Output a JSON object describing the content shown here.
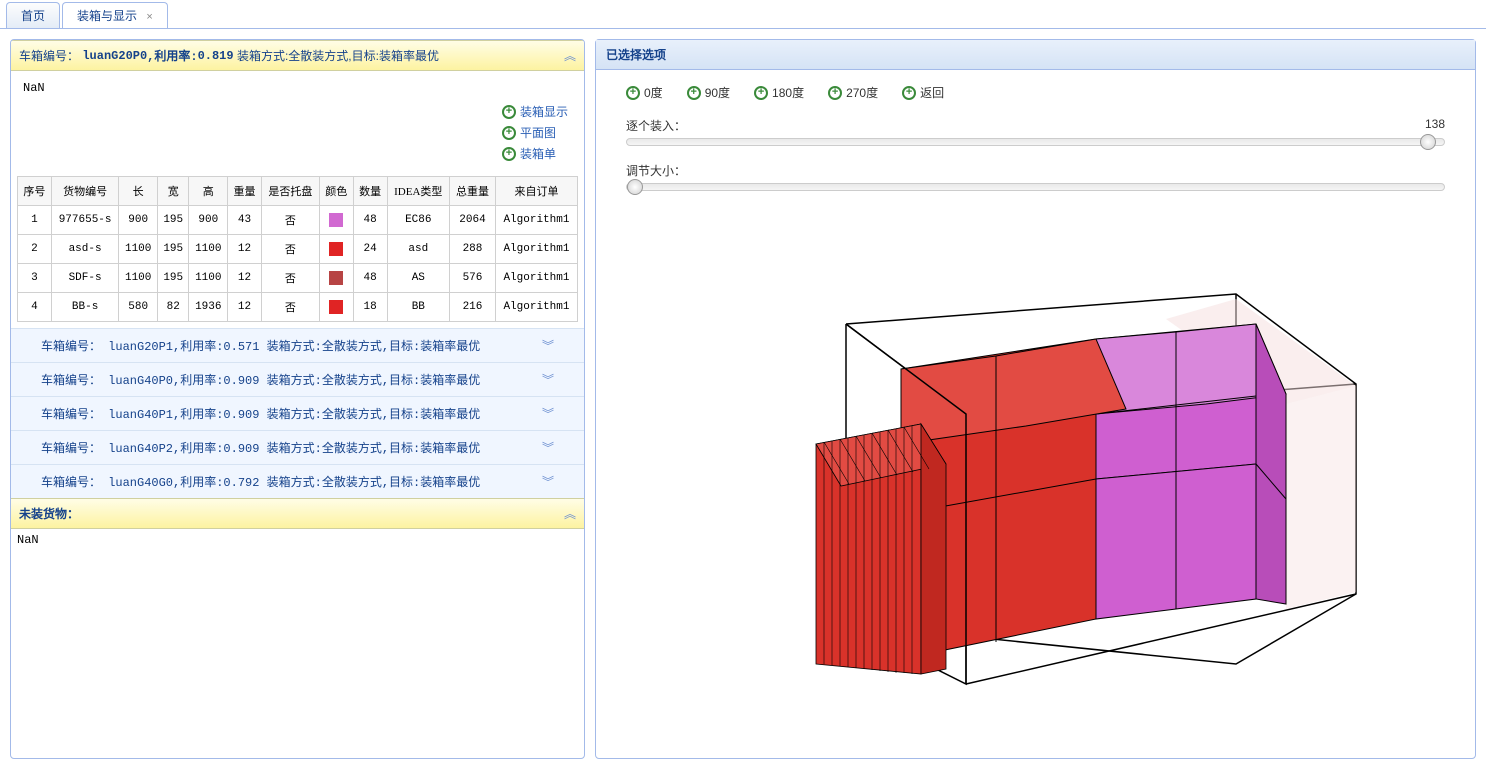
{
  "tabs": {
    "home": "首页",
    "pack": "装箱与显示"
  },
  "leftPanel": {
    "header": {
      "prefix": "车箱编号：",
      "id": "luanG20P0",
      "rateLabel": ",利用率:",
      "rate": "0.819",
      "methodLabel": "装箱方式:",
      "method": "全散装方式",
      "targetLabel": ",目标:",
      "target": "装箱率最优"
    },
    "nan": "NaN",
    "actions": {
      "showPack": "装箱显示",
      "planView": "平面图",
      "packList": "装箱单"
    },
    "tableHeaders": {
      "seq": "序号",
      "cargoId": "货物编号",
      "len": "长",
      "wid": "宽",
      "hei": "高",
      "wgt": "重量",
      "pallet": "是否托盘",
      "color": "颜色",
      "qty": "数量",
      "ideaType": "IDEA类型",
      "totalWgt": "总重量",
      "fromOrder": "来自订单"
    },
    "rows": [
      {
        "seq": "1",
        "cargoId": "977655-s",
        "len": "900",
        "wid": "195",
        "hei": "900",
        "wgt": "43",
        "pallet": "否",
        "color": "#d169d1",
        "qty": "48",
        "ideaType": "EC86",
        "totalWgt": "2064",
        "fromOrder": "Algorithm1"
      },
      {
        "seq": "2",
        "cargoId": "asd-s",
        "len": "1100",
        "wid": "195",
        "hei": "1100",
        "wgt": "12",
        "pallet": "否",
        "color": "#e02424",
        "qty": "24",
        "ideaType": "asd",
        "totalWgt": "288",
        "fromOrder": "Algorithm1"
      },
      {
        "seq": "3",
        "cargoId": "SDF-s",
        "len": "1100",
        "wid": "195",
        "hei": "1100",
        "wgt": "12",
        "pallet": "否",
        "color": "#b74444",
        "qty": "48",
        "ideaType": "AS",
        "totalWgt": "576",
        "fromOrder": "Algorithm1"
      },
      {
        "seq": "4",
        "cargoId": "BB-s",
        "len": "580",
        "wid": "82",
        "hei": "1936",
        "wgt": "12",
        "pallet": "否",
        "color": "#e02424",
        "qty": "18",
        "ideaType": "BB",
        "totalWgt": "216",
        "fromOrder": "Algorithm1"
      }
    ],
    "subRows": [
      "车箱编号： luanG20P1,利用率:0.571 装箱方式:全散装方式,目标:装箱率最优",
      "车箱编号： luanG40P0,利用率:0.909 装箱方式:全散装方式,目标:装箱率最优",
      "车箱编号： luanG40P1,利用率:0.909 装箱方式:全散装方式,目标:装箱率最优",
      "车箱编号： luanG40P2,利用率:0.909 装箱方式:全散装方式,目标:装箱率最优",
      "车箱编号： luanG40G0,利用率:0.792 装箱方式:全散装方式,目标:装箱率最优"
    ],
    "unloadedHeader": "未装货物：",
    "nan2": "NaN"
  },
  "rightPanel": {
    "header": "已选择选项",
    "rotations": {
      "r0": "0度",
      "r90": "90度",
      "r180": "180度",
      "r270": "270度",
      "back": "返回"
    },
    "slider1": {
      "label": "逐个装入：",
      "value": "138",
      "pos": 98
    },
    "slider2": {
      "label": "调节大小：",
      "pos": 1
    }
  },
  "chart_data": {
    "type": "3d-container-packing",
    "description": "Isometric 3D view of a rectangular shipping container packed with colored cargo boxes",
    "container": {
      "id": "luanG20P0",
      "utilization": 0.819
    },
    "cargo_groups": [
      {
        "color": "#e02424",
        "approx_count_visible": 30,
        "shape": "thin vertical slabs front-left",
        "cargo_ids": [
          "asd-s",
          "SDF-s",
          "BB-s"
        ]
      },
      {
        "color": "#d169d1",
        "approx_count_visible": 8,
        "shape": "large blocks rear-right",
        "cargo_ids": [
          "977655-s"
        ]
      }
    ],
    "empty_space": "transparent rear section of container"
  }
}
